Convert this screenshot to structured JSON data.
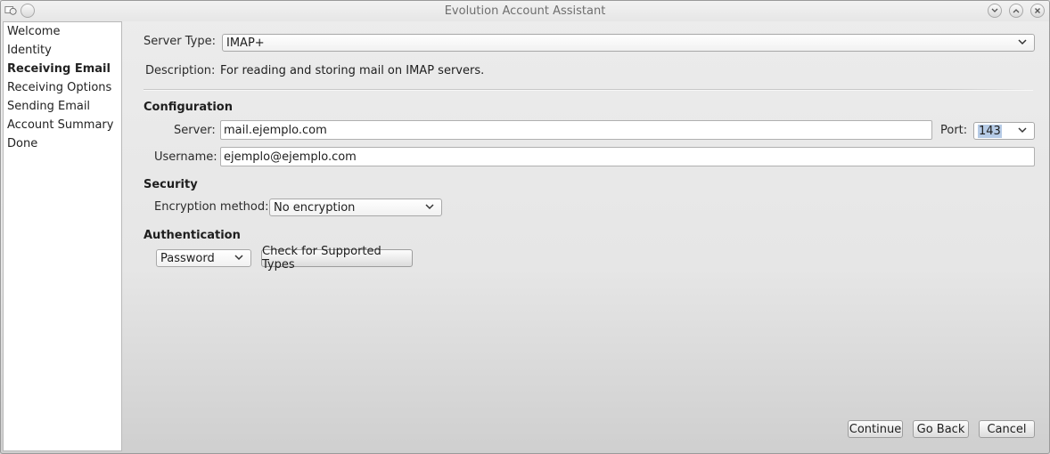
{
  "window": {
    "title": "Evolution Account Assistant"
  },
  "titlebar": {
    "left_icons": [
      "app-icon",
      "menu-icon"
    ],
    "right_icons": [
      "minimize-icon",
      "maximize-icon",
      "close-icon"
    ]
  },
  "sidebar": {
    "items": [
      {
        "label": "Welcome",
        "active": false
      },
      {
        "label": "Identity",
        "active": false
      },
      {
        "label": "Receiving Email",
        "active": true
      },
      {
        "label": "Receiving Options",
        "active": false
      },
      {
        "label": "Sending Email",
        "active": false
      },
      {
        "label": "Account Summary",
        "active": false
      },
      {
        "label": "Done",
        "active": false
      }
    ]
  },
  "server_type": {
    "label": "Server Type:",
    "value": "IMAP+"
  },
  "description": {
    "label": "Description:",
    "text": "For reading and storing mail on IMAP servers."
  },
  "configuration": {
    "heading": "Configuration",
    "server_label": "Server:",
    "server_value": "mail.ejemplo.com",
    "port_label": "Port:",
    "port_value": "143",
    "username_label": "Username:",
    "username_value": "ejemplo@ejemplo.com"
  },
  "security": {
    "heading": "Security",
    "encryption_label": "Encryption method:",
    "encryption_value": "No encryption"
  },
  "authentication": {
    "heading": "Authentication",
    "method_value": "Password",
    "check_button": "Check for Supported Types"
  },
  "footer": {
    "continue": "Continue",
    "go_back": "Go Back",
    "cancel": "Cancel"
  }
}
